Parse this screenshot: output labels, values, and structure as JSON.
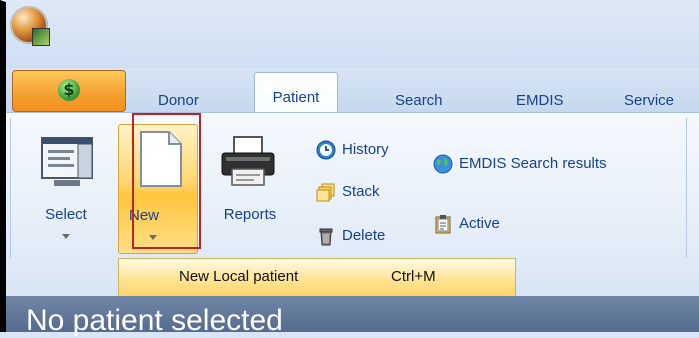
{
  "tabs": {
    "donor": "Donor",
    "patient": "Patient",
    "search": "Search",
    "emdis": "EMDIS",
    "service": "Service"
  },
  "app_button": {
    "symbol": "$"
  },
  "ribbon": {
    "select_label": "Select",
    "new_label": "New",
    "reports_label": "Reports",
    "history_label": "History",
    "stack_label": "Stack",
    "delete_label": "Delete",
    "emdis_search_results_label": "EMDIS Search results",
    "active_label": "Active"
  },
  "dropdown": {
    "item_label": "New Local patient",
    "shortcut": "Ctrl+M"
  },
  "status": {
    "text": "No patient selected"
  },
  "colors": {
    "tab_text": "#15428b",
    "ribbon_bg": "#e7eff9",
    "highlight_border": "#c22222",
    "dropdown_bg": "#ffe59a",
    "app_button_bg": "#f4a233"
  }
}
